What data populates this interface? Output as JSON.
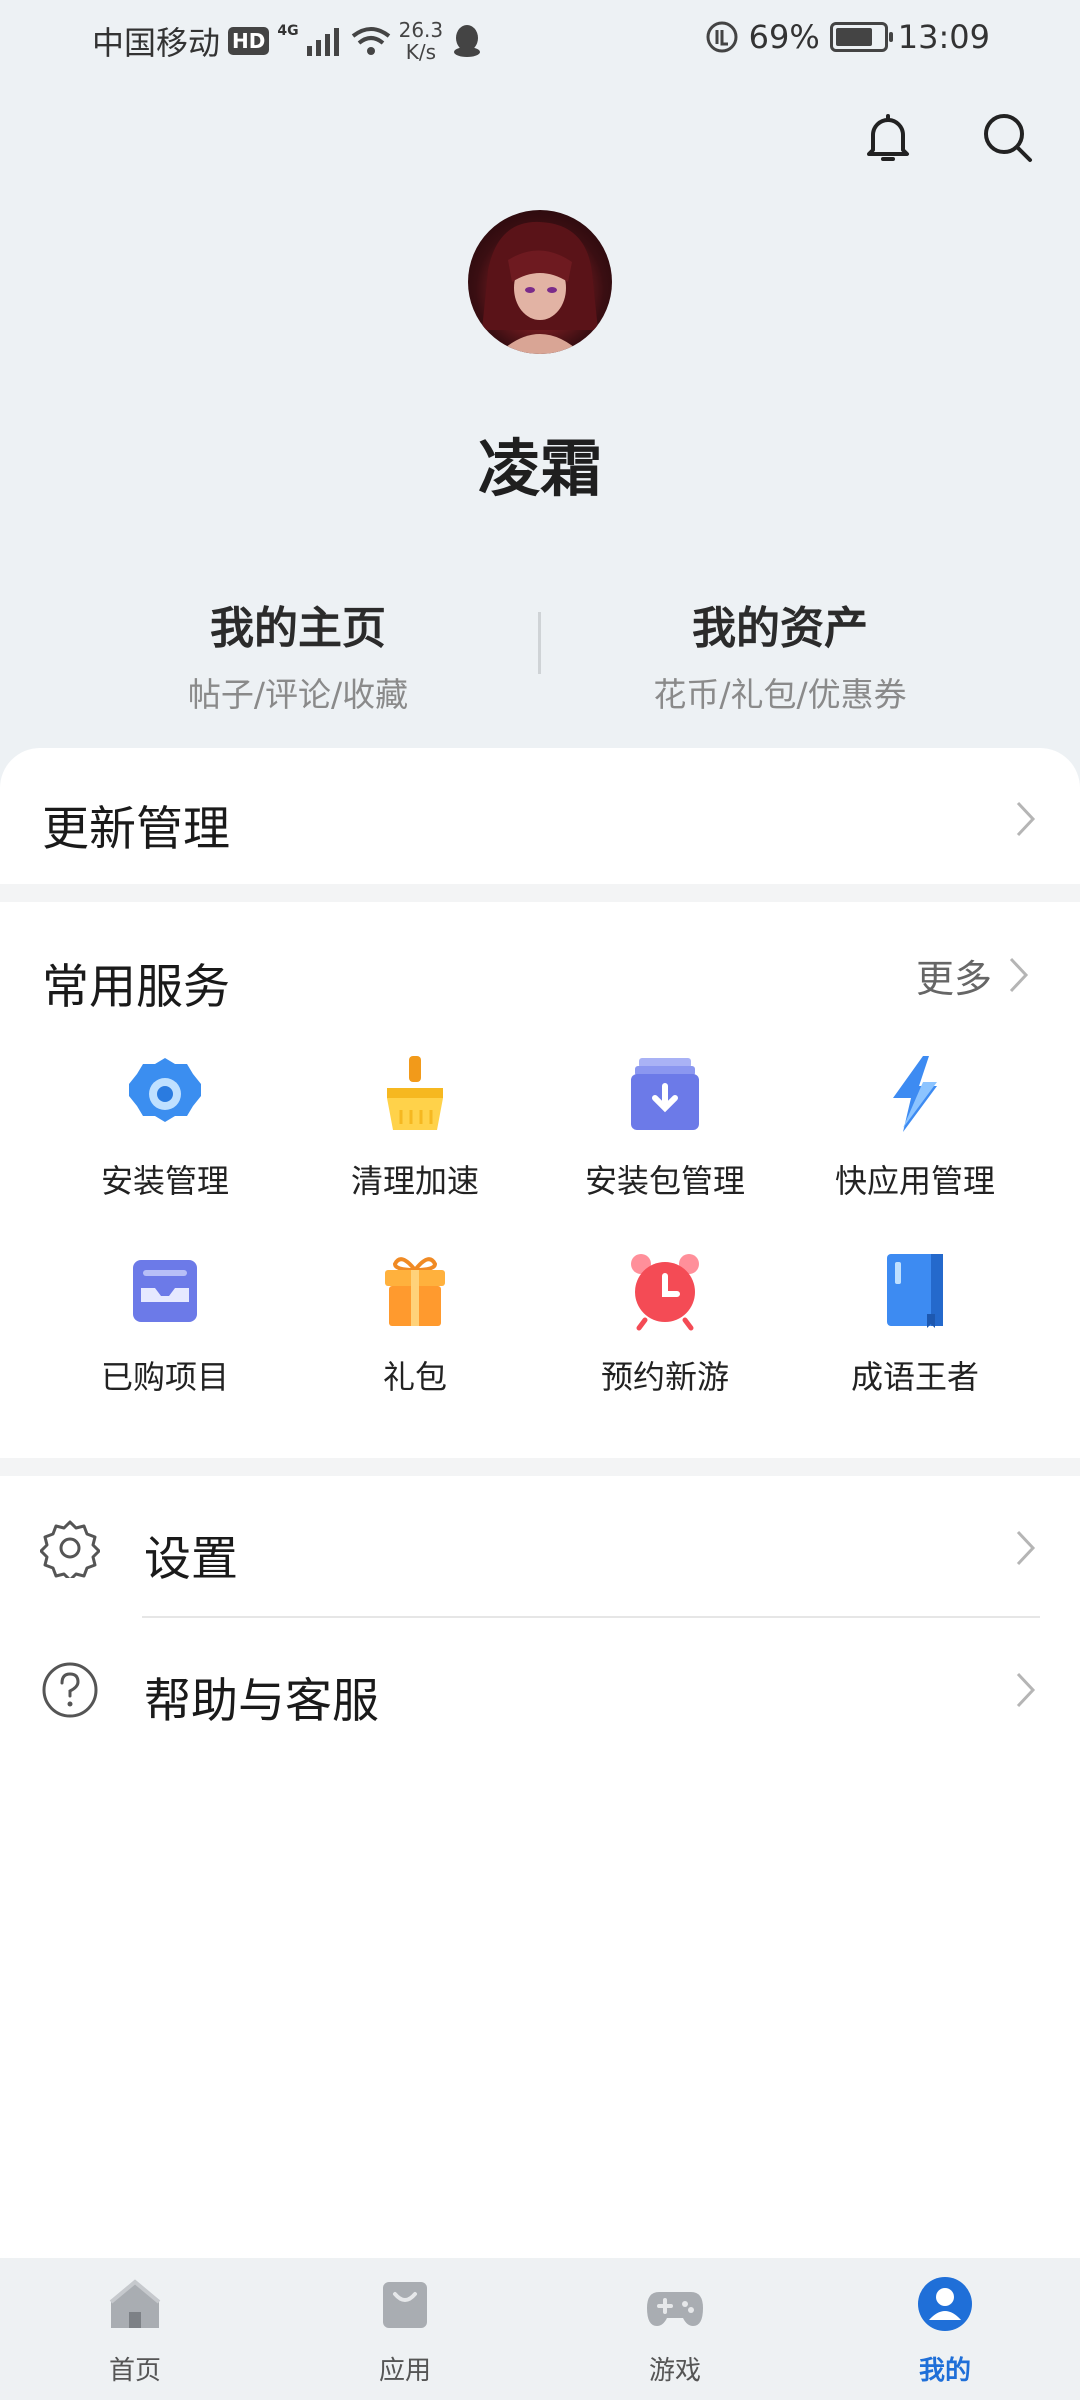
{
  "status_bar": {
    "carrier": "中国移动",
    "hd": "HD",
    "network": "4G",
    "speed_value": "26.3",
    "speed_unit": "K/s",
    "battery": "69%",
    "battery_level": 0.69,
    "time": "13:09"
  },
  "profile": {
    "username": "凌霜",
    "home_title": "我的主页",
    "home_sub": "帖子/评论/收藏",
    "assets_title": "我的资产",
    "assets_sub": "花币/礼包/优惠券"
  },
  "update": {
    "label": "更新管理"
  },
  "services": {
    "title": "常用服务",
    "more": "更多",
    "items": [
      {
        "label": "安装管理",
        "icon": "gear-blue-icon"
      },
      {
        "label": "清理加速",
        "icon": "broom-icon"
      },
      {
        "label": "安装包管理",
        "icon": "package-download-icon"
      },
      {
        "label": "快应用管理",
        "icon": "lightning-icon"
      },
      {
        "label": "已购项目",
        "icon": "purchased-tray-icon"
      },
      {
        "label": "礼包",
        "icon": "gift-icon"
      },
      {
        "label": "预约新游",
        "icon": "alarm-clock-icon"
      },
      {
        "label": "成语王者",
        "icon": "book-icon"
      }
    ]
  },
  "settings": {
    "label": "设置"
  },
  "help": {
    "label": "帮助与客服"
  },
  "bottom_nav": [
    {
      "label": "首页",
      "icon": "home-icon"
    },
    {
      "label": "应用",
      "icon": "bag-icon"
    },
    {
      "label": "游戏",
      "icon": "gamepad-icon"
    },
    {
      "label": "我的",
      "icon": "user-icon",
      "active": true
    }
  ],
  "colors": {
    "accent": "#1f6fd8",
    "background_top": "#edf1f4"
  }
}
